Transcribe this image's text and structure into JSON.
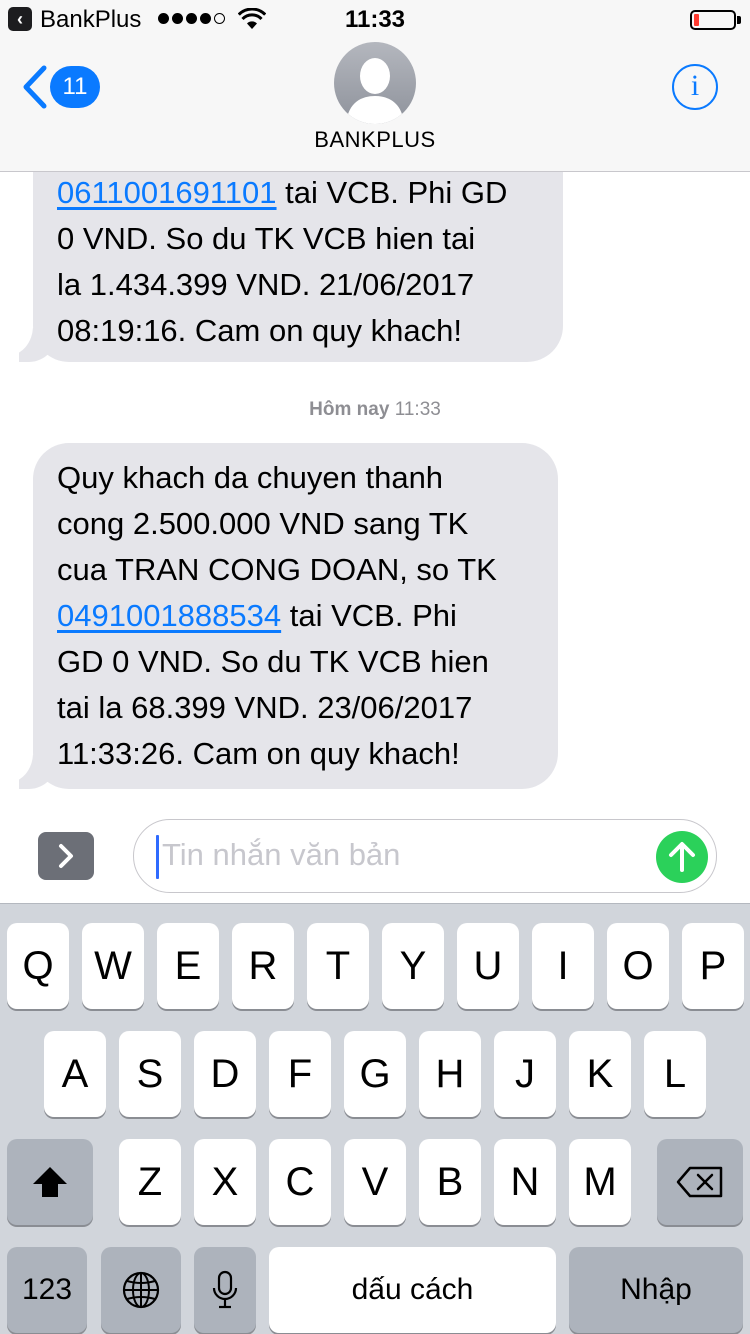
{
  "status_bar": {
    "carrier": "BankPlus",
    "time": "11:33"
  },
  "header": {
    "back_badge": "11",
    "contact_name": "BANKPLUS",
    "info_label": "i"
  },
  "messages": [
    {
      "lines": [
        "tai VCB. Phi GD",
        "0 VND. So du TK VCB hien tai",
        "la 1.434.399 VND. 21/06/2017",
        "08:19:16. Cam on quy khach!"
      ],
      "account_link": "0611001691101"
    },
    {
      "lines": [
        "Quy khach da chuyen thanh",
        "cong 2.500.000 VND sang TK",
        "cua TRAN CONG DOAN, so TK",
        "tai VCB. Phi",
        "GD 0 VND. So du TK VCB hien",
        "tai la 68.399 VND. 23/06/2017",
        "11:33:26. Cam on quy khach!"
      ],
      "account_link": "0491001888534"
    }
  ],
  "timestamp": {
    "day": "Hôm nay",
    "time": "11:33"
  },
  "composer": {
    "placeholder": "Tin nhắn văn bản"
  },
  "keyboard": {
    "row1": [
      "Q",
      "W",
      "E",
      "R",
      "T",
      "Y",
      "U",
      "I",
      "O",
      "P"
    ],
    "row2": [
      "A",
      "S",
      "D",
      "F",
      "G",
      "H",
      "J",
      "K",
      "L"
    ],
    "row3": [
      "Z",
      "X",
      "C",
      "V",
      "B",
      "N",
      "M"
    ],
    "numbers_key": "123",
    "space_key": "dấu cách",
    "return_key": "Nhập"
  },
  "colors": {
    "ios_blue": "#0a7aff",
    "bubble_gray": "#e5e5ea",
    "send_green": "#2bd15a",
    "battery_red": "#ff3b30"
  },
  "icons": [
    "back-app-icon",
    "wifi-icon",
    "battery-icon",
    "back-chevron-icon",
    "avatar-icon",
    "info-icon",
    "apps-chevron-icon",
    "send-arrow-icon",
    "shift-icon",
    "backspace-icon",
    "globe-icon",
    "microphone-icon"
  ]
}
